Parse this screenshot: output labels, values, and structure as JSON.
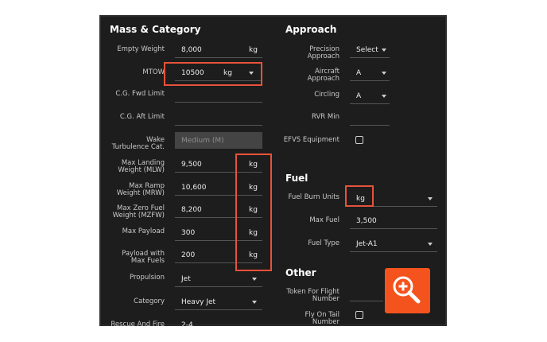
{
  "mass": {
    "title": "Mass & Category",
    "empty_weight": {
      "label": "Empty Weight",
      "value": "8,000",
      "unit": "kg"
    },
    "mtow": {
      "label": "MTOW",
      "value": "10500",
      "unit": "kg"
    },
    "cg_fwd": {
      "label": "C.G. Fwd Limit"
    },
    "cg_aft": {
      "label": "C.G. Aft Limit"
    },
    "wake": {
      "label_line1": "Wake",
      "label_line2": "Turbulence Cat.",
      "placeholder": "Medium (M)"
    },
    "mlw": {
      "label_line1": "Max Landing",
      "label_line2": "Weight (MLW)",
      "value": "9,500",
      "unit": "kg"
    },
    "mrw": {
      "label_line1": "Max Ramp",
      "label_line2": "Weight (MRW)",
      "value": "10,600",
      "unit": "kg"
    },
    "mzfw": {
      "label_line1": "Max Zero Fuel",
      "label_line2": "Weight (MZFW)",
      "value": "8,200",
      "unit": "kg"
    },
    "payload": {
      "label": "Max Payload",
      "value": "300",
      "unit": "kg"
    },
    "payload_max_fuel": {
      "label_line1": "Payload with",
      "label_line2": "Max Fuels",
      "value": "200",
      "unit": "kg"
    },
    "propulsion": {
      "label": "Propulsion",
      "value": "Jet"
    },
    "category": {
      "label": "Category",
      "value": "Heavy Jet"
    },
    "rescue": {
      "label": "Rescue And Fire",
      "value": "2-4"
    }
  },
  "approach": {
    "title": "Approach",
    "precision": {
      "label_line1": "Precision",
      "label_line2": "Approach",
      "value": "Select"
    },
    "aircraft": {
      "label_line1": "Aircraft",
      "label_line2": "Approach",
      "value": "A"
    },
    "circling": {
      "label": "Circling",
      "value": "A"
    },
    "rvr": {
      "label": "RVR Min"
    },
    "efvs": {
      "label": "EFVS Equipment"
    }
  },
  "fuel": {
    "title": "Fuel",
    "burn_units": {
      "label": "Fuel Burn Units",
      "value": "kg"
    },
    "max_fuel": {
      "label": "Max Fuel",
      "value": "3,500"
    },
    "fuel_type": {
      "label": "Fuel Type",
      "value": "Jet-A1"
    }
  },
  "other": {
    "title": "Other",
    "token": {
      "label_line1": "Token For Flight",
      "label_line2": "Number"
    },
    "fly_tail": {
      "label_line1": "Fly On Tail",
      "label_line2": "Number"
    }
  },
  "colors": {
    "highlight": "#e8523a",
    "zoom_button": "#f4531d",
    "panel": "#1d1d1d"
  },
  "icons": {
    "zoom": "zoom-in-icon"
  }
}
